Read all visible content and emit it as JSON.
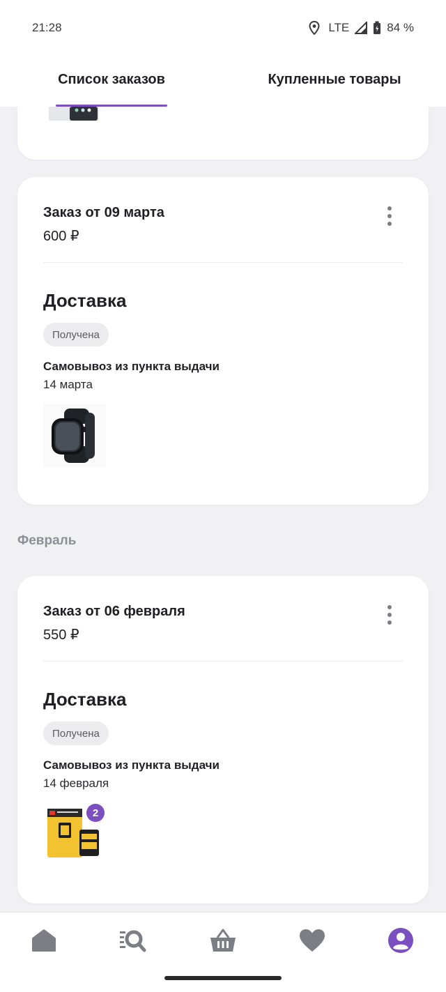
{
  "status_bar": {
    "time": "21:28",
    "network": "LTE",
    "battery": "84 %"
  },
  "tabs": [
    {
      "label": "Список заказов",
      "active": true
    },
    {
      "label": "Купленные товары",
      "active": false
    }
  ],
  "orders": [
    {
      "title": "Заказ от 09 марта",
      "price": "600 ₽",
      "section": "Доставка",
      "status": "Получена",
      "method": "Самовывоз из пункта выдачи",
      "date": "14 марта"
    },
    {
      "month": "Февраль",
      "title": "Заказ от 06 февраля",
      "price": "550 ₽",
      "section": "Доставка",
      "status": "Получена",
      "method": "Самовывоз из пункта выдачи",
      "date": "14 февраля",
      "item_count": "2"
    }
  ],
  "colors": {
    "accent": "#7b4fbf",
    "background": "#f1f1f4",
    "nav_icon": "#7d7d85"
  },
  "nav": [
    "home-icon",
    "catalog-search-icon",
    "basket-icon",
    "heart-icon",
    "profile-icon"
  ]
}
